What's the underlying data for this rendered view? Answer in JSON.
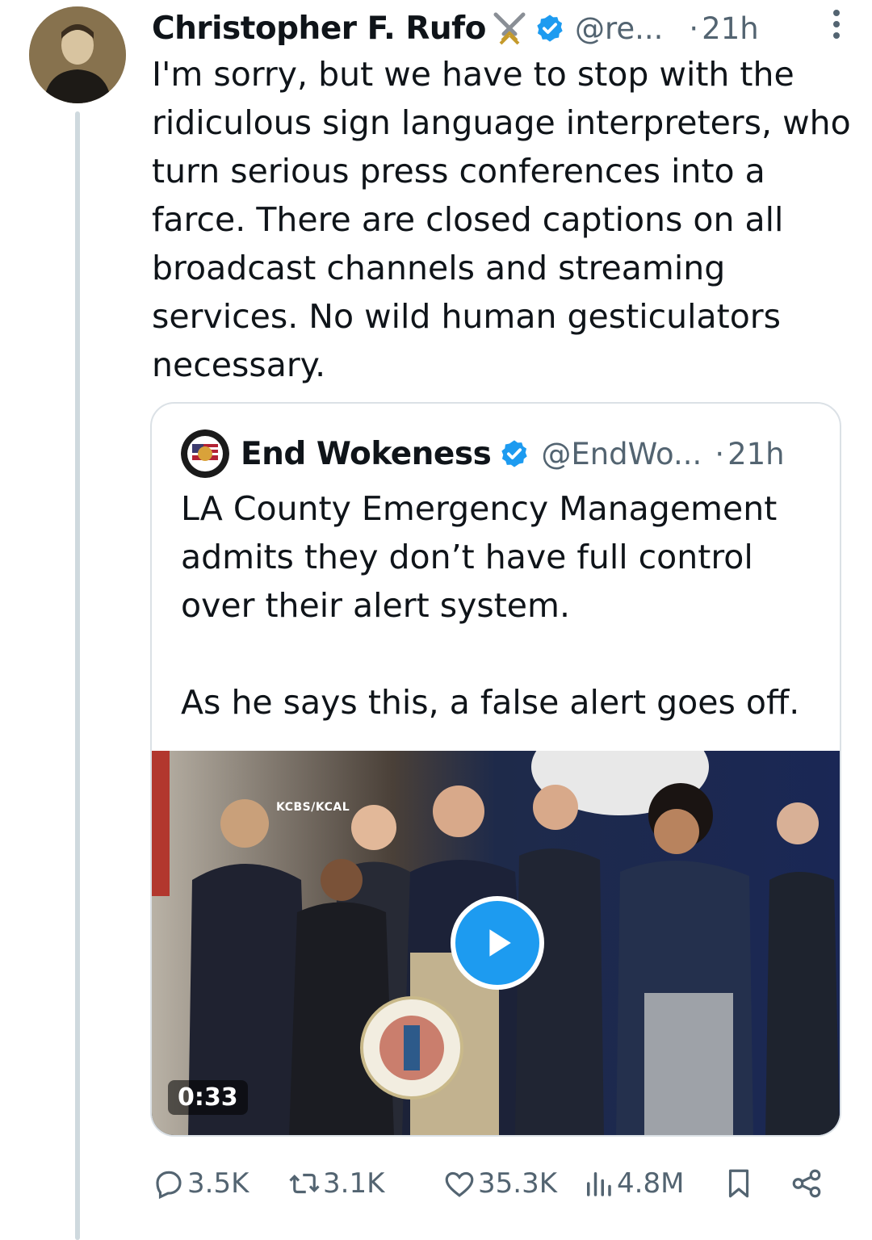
{
  "tweet": {
    "author": {
      "name": "Christopher F. Rufo",
      "handle": "@re...",
      "time": "21h",
      "dot": "·",
      "badge_icon": "swords-icon",
      "verified_icon": "verified-icon",
      "verified_color": "#1d9bf0"
    },
    "text": "I'm sorry, but we have to stop with the ridiculous sign language interpreters, who turn serious press conferences into a farce. There are closed captions on all broadcast channels and streaming services. No wild human gesticulators necessary."
  },
  "quote": {
    "author": {
      "name": "End Wokeness",
      "handle": "@EndWo...",
      "time": "21h",
      "dot": "·"
    },
    "text": "LA County Emergency Management admits they don’t have full control over their alert system.\n\nAs he says this, a false alert goes off.",
    "media": {
      "type": "video",
      "duration": "0:33",
      "overlay_label": "KCBS/KCAL"
    }
  },
  "actions": {
    "replies": "3.5K",
    "retweets": "3.1K",
    "likes": "35.3K",
    "views": "4.8M"
  },
  "colors": {
    "accent": "#1d9bf0",
    "secondary_text": "#536471",
    "border": "#dbe1e6",
    "thread_line": "#cfd9de"
  }
}
